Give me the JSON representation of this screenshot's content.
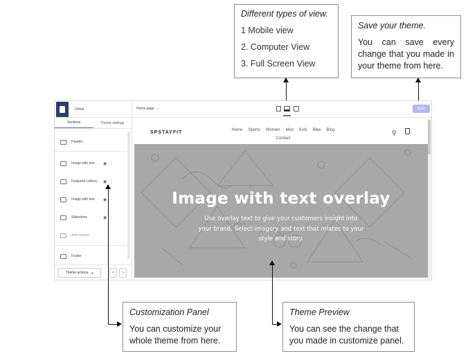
{
  "callouts": {
    "views": {
      "title": "Different types of view.",
      "items": [
        "1 Mobile view",
        "2. Computer View",
        "3. Full Screen View"
      ]
    },
    "save": {
      "title": "Save your theme.",
      "text": "You can save every change that you made in your theme from here."
    },
    "customization": {
      "title": "Customization Panel",
      "text": "You can customize your whole theme from here."
    },
    "preview": {
      "title": "Theme Preview",
      "text": "You can see the change that you made in customize panel."
    }
  },
  "editor": {
    "theme_name": "Debut",
    "tabs": [
      "Sections",
      "Theme settings"
    ],
    "sections": {
      "header": "Header",
      "items": [
        {
          "label": "Image with text ...",
          "icon": "image-text-icon"
        },
        {
          "label": "Featured collecti...",
          "icon": "collection-icon"
        },
        {
          "label": "Image with text",
          "icon": "image-text-icon"
        },
        {
          "label": "Slideshow",
          "icon": "slideshow-icon"
        }
      ],
      "add_section": "Add section",
      "footer": "Footer"
    },
    "theme_actions": "Theme actions",
    "page_select": "Home page",
    "save_label": "Save"
  },
  "store": {
    "name": "SPSTAYFIT",
    "nav": [
      "Home",
      "Sports",
      "Women",
      "Men",
      "Kids",
      "Bike",
      "Blog",
      "Contact"
    ],
    "hero_title": "Image with text overlay",
    "hero_text": "Use overlay text to give your customers insight into your brand. Select imagery and text that relates to your style and story."
  },
  "colors": {
    "accent": "#5c6ac4",
    "save_button": "#b3b9e8",
    "hero_bg": "#a8a8a8",
    "logo_bg": "#2f3d62"
  }
}
